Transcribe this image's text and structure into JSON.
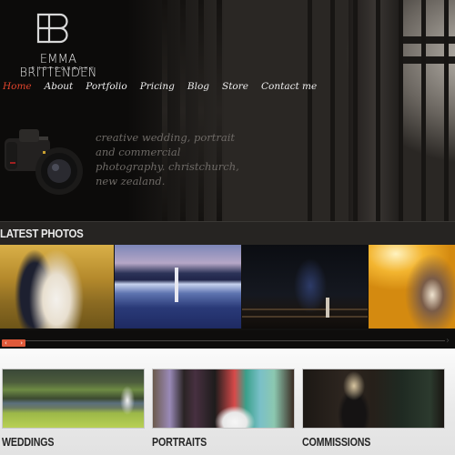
{
  "brand": {
    "monogram": "EB",
    "name": "EMMA BRITTENDEN",
    "subtitle": "PHOTOGRAPHY"
  },
  "nav": {
    "items": [
      {
        "label": "Home",
        "active": true
      },
      {
        "label": "About",
        "active": false
      },
      {
        "label": "Portfolio",
        "active": false
      },
      {
        "label": "Pricing",
        "active": false
      },
      {
        "label": "Blog",
        "active": false
      },
      {
        "label": "Store",
        "active": false
      },
      {
        "label": "Contact me",
        "active": false
      }
    ],
    "active_color": "#e0442c"
  },
  "hero": {
    "tagline_lines": [
      "creative wedding, portrait",
      "and commercial",
      "photography. christchurch,",
      "new zealand."
    ],
    "camera_icon": "dslr-camera-image",
    "photo": "bride-behind-iron-gate"
  },
  "latest": {
    "title": "LATEST PHOTOS",
    "photos": [
      {
        "subject": "couple-kissing-golden-field"
      },
      {
        "subject": "couple-reflection-lake-dusk"
      },
      {
        "subject": "couple-night-fence-tree"
      },
      {
        "subject": "couple-sunset-embrace"
      }
    ],
    "slider": {
      "prev_icon": "‹",
      "next_icon": "›",
      "accent": "#e05a3a",
      "position": 0
    }
  },
  "categories": [
    {
      "label": "WEDDINGS",
      "image": "couple-hillside-harbour"
    },
    {
      "label": "PORTRAITS",
      "image": "wedding-party-group"
    },
    {
      "label": "COMMISSIONS",
      "image": "woman-in-barn"
    }
  ]
}
